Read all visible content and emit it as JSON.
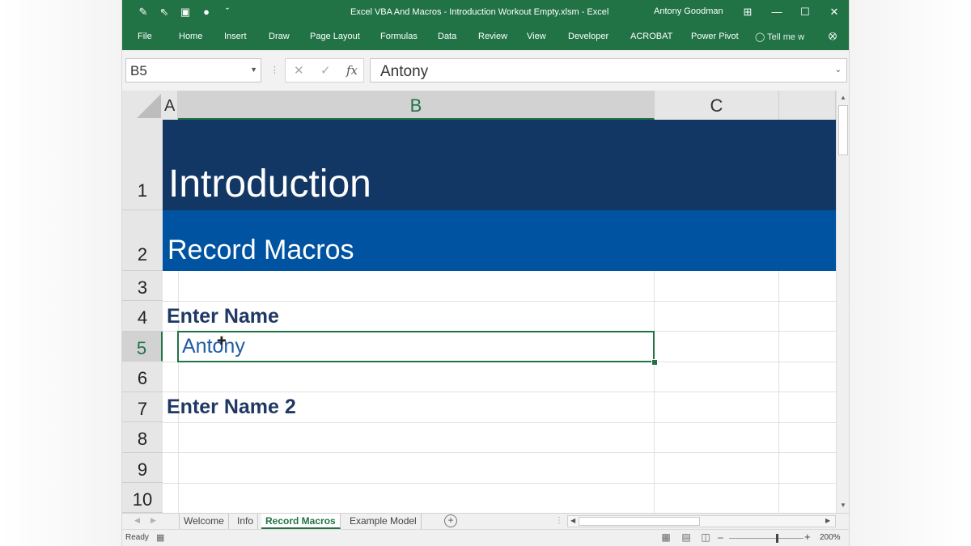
{
  "window": {
    "title": "Excel VBA And Macros - Introduction Workout Empty.xlsm  -  Excel",
    "user": "Antony Goodman",
    "controls": [
      "⊞",
      "—",
      "☐",
      "✕"
    ]
  },
  "quick_access": [
    {
      "icon": "draw-icon",
      "glyph": "✎"
    },
    {
      "icon": "pointer-icon",
      "glyph": "⇖"
    },
    {
      "icon": "camera-icon",
      "glyph": "▣"
    },
    {
      "icon": "person-icon",
      "glyph": "●"
    },
    {
      "icon": "customize-arrow-icon",
      "glyph": "ˇ"
    }
  ],
  "ribbon": {
    "tabs": [
      "File",
      "Home",
      "Insert",
      "Draw",
      "Page Layout",
      "Formulas",
      "Data",
      "Review",
      "View",
      "Developer",
      "ACROBAT",
      "Power Pivot"
    ],
    "tell_me": "Tell me w",
    "share_glyph": "⭙"
  },
  "formula_bar": {
    "name_box": "B5",
    "cancel_glyph": "✕",
    "enter_glyph": "✓",
    "fx_label": "fx",
    "value": "Antony"
  },
  "columns": [
    "A",
    "B",
    "C"
  ],
  "rows": [
    "1",
    "2",
    "3",
    "4",
    "5",
    "6",
    "7",
    "8",
    "9",
    "10"
  ],
  "cells": {
    "B1": "Introduction",
    "B2": "Record Macros",
    "B4": "Enter Name",
    "B5": "Antony",
    "B7": "Enter Name 2"
  },
  "active_cell": "B5",
  "sheets": [
    "Welcome",
    "Info",
    "Record Macros",
    "Example Model"
  ],
  "active_sheet": "Record Macros",
  "status": {
    "ready": "Ready",
    "zoom": "200%"
  },
  "colors": {
    "excel_green": "#217346",
    "banner_dark": "#133764",
    "banner_blue": "#0053a0",
    "heading_text": "#1f3864"
  }
}
